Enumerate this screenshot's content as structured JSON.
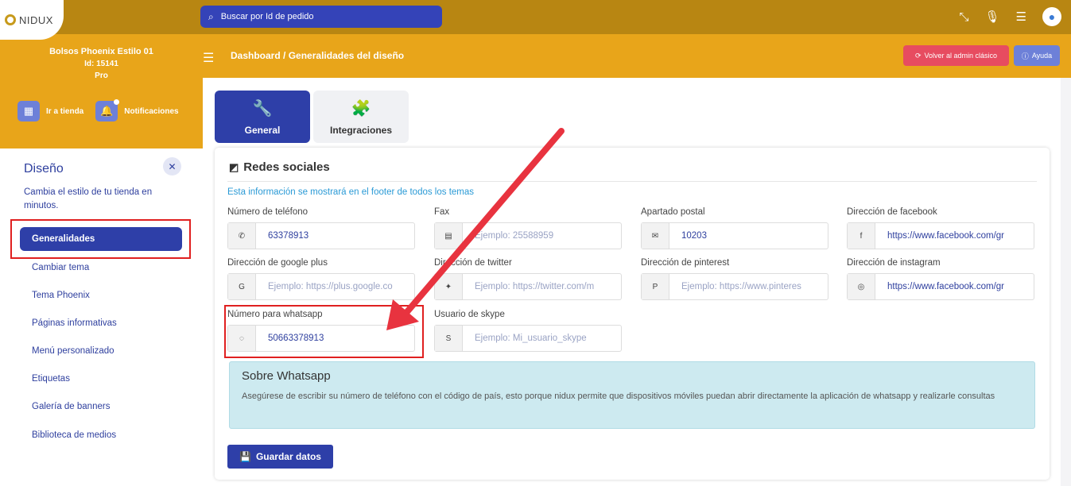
{
  "brand": {
    "logo_text": "NIDUX"
  },
  "search": {
    "placeholder": "Buscar por Id de pedido"
  },
  "store": {
    "name": "Bolsos Phoenix Estilo 01",
    "id": "Id: 15141",
    "plan": "Pro"
  },
  "side_actions": {
    "store_label": "Ir a tienda",
    "notif_label": "Notificaciones"
  },
  "sidebar": {
    "title": "Diseño",
    "description": "Cambia el estilo de tu tienda en minutos.",
    "items": [
      {
        "label": "Generalidades"
      },
      {
        "label": "Cambiar tema"
      },
      {
        "label": "Tema Phoenix"
      },
      {
        "label": "Páginas informativas"
      },
      {
        "label": "Menú personalizado"
      },
      {
        "label": "Etiquetas"
      },
      {
        "label": "Galería de banners"
      },
      {
        "label": "Biblioteca de medios"
      }
    ]
  },
  "breadcrumb": {
    "root": "Dashboard",
    "separator": "/",
    "current": "Generalidades del diseño"
  },
  "header_buttons": {
    "old_admin": "Volver al admin clásico",
    "help": "Ayuda"
  },
  "tabs": [
    {
      "label": "General"
    },
    {
      "label": "Integraciones"
    }
  ],
  "card": {
    "title": "Redes sociales",
    "note": "Esta información se mostrará en el footer de todos los temas",
    "fields": [
      {
        "label": "Número de teléfono",
        "value": "63378913",
        "placeholder": "",
        "icon": "phone-icon"
      },
      {
        "label": "Fax",
        "value": "",
        "placeholder": "Ejemplo: 25588959",
        "icon": "fax-icon"
      },
      {
        "label": "Apartado postal",
        "value": "10203",
        "placeholder": "",
        "icon": "envelope-icon"
      },
      {
        "label": "Dirección de facebook",
        "value": "https://www.facebook.com/gr",
        "placeholder": "",
        "icon": "facebook-icon"
      },
      {
        "label": "Dirección de google plus",
        "value": "",
        "placeholder": "Ejemplo: https://plus.google.co",
        "icon": "google-plus-icon"
      },
      {
        "label": "Dirección de twitter",
        "value": "",
        "placeholder": "Ejemplo: https://twitter.com/m",
        "icon": "twitter-icon"
      },
      {
        "label": "Dirección de pinterest",
        "value": "",
        "placeholder": "Ejemplo: https://www.pinteres",
        "icon": "pinterest-icon"
      },
      {
        "label": "Dirección de instagram",
        "value": "https://www.facebook.com/gr",
        "placeholder": "",
        "icon": "instagram-icon"
      },
      {
        "label": "Número para whatsapp",
        "value": "50663378913",
        "placeholder": "",
        "icon": "whatsapp-icon"
      },
      {
        "label": "Usuario de skype",
        "value": "",
        "placeholder": "Ejemplo: Mi_usuario_skype",
        "icon": "skype-icon"
      }
    ],
    "alert": {
      "title": "Sobre Whatsapp",
      "text": "Asegúrese de escribir su número de teléfono con el código de país, esto porque nidux permite que dispositivos móviles puedan abrir directamente la aplicación de whatsapp y realizarle consultas"
    },
    "save_label": "Guardar datos"
  },
  "colors": {
    "topbar": "#b88612",
    "accent": "#e8a51a",
    "primary": "#2e3fa8",
    "highlight": "#e02020"
  }
}
